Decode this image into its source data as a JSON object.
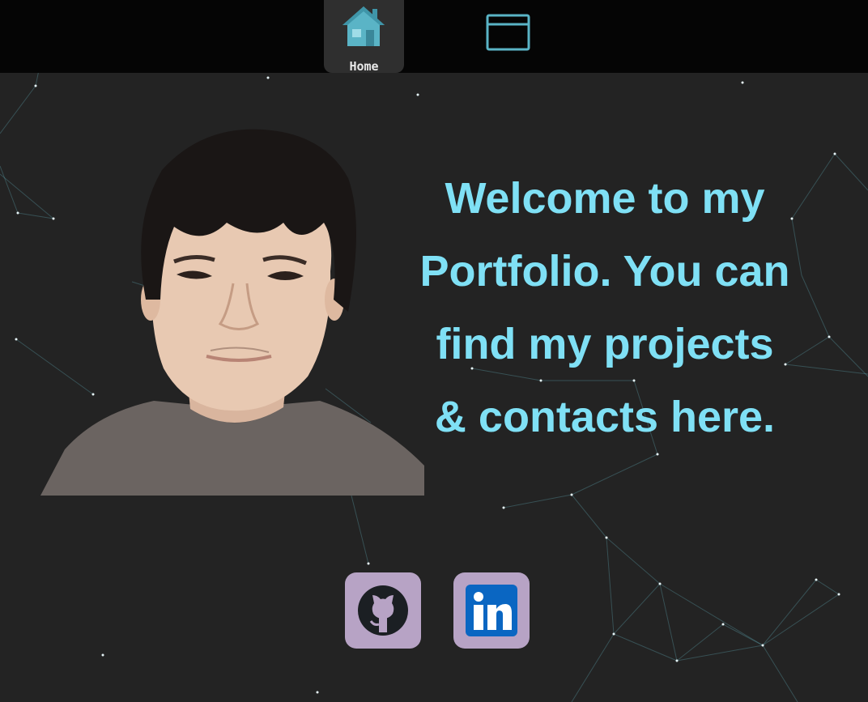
{
  "nav": {
    "home": {
      "label": "Home",
      "icon": "home-icon",
      "active": true
    },
    "projects": {
      "icon": "browser-window-icon"
    }
  },
  "hero": {
    "photo_alt": "profile-photo",
    "welcome_lines": [
      "Welcome to my",
      "Portfolio. You can",
      "find my projects",
      "& contacts here."
    ]
  },
  "social": {
    "github": {
      "icon": "github-icon"
    },
    "linkedin": {
      "icon": "linkedin-icon",
      "text": "in"
    }
  },
  "colors": {
    "background": "#232323",
    "topbar": "#050505",
    "nav_active": "#2f2f2f",
    "accent": "#7fe0f5",
    "icon_teal": "#5ab4c6",
    "social_bg": "#b7a3c5",
    "linkedin_blue": "#0a66c2"
  }
}
